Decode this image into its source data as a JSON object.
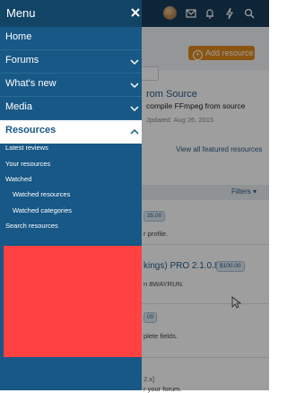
{
  "menu": {
    "title": "Menu",
    "items": [
      {
        "label": "Home",
        "expanded": false
      },
      {
        "label": "Forums",
        "expanded": false
      },
      {
        "label": "What's new",
        "expanded": false
      },
      {
        "label": "Media",
        "expanded": false
      },
      {
        "label": "Resources",
        "expanded": true
      }
    ],
    "resources_submenu": [
      "Latest reviews",
      "Your resources",
      "Watched",
      "Watched resources",
      "Watched categories",
      "Search resources"
    ]
  },
  "header_icons": [
    "avatar",
    "envelope-icon",
    "bell-icon",
    "bolt-icon",
    "search-icon"
  ],
  "background": {
    "add_button": "Add resource…",
    "featured": {
      "title": "rom Source",
      "description": "compile FFmpeg from source",
      "updated": "Jpdated: Aug 26, 2015"
    },
    "view_all": "View all featured resources",
    "filters": "Filters ▾",
    "rows": [
      {
        "price": "35.00",
        "text": "r profile."
      },
      {
        "title": "kings) PRO 2.1.0.8",
        "price": "$100.00",
        "text": "n 8WAYRUN."
      },
      {
        "price": "00",
        "text": "plete fields."
      },
      {
        "tag": "2.x]",
        "text": "r your forum."
      }
    ]
  },
  "colors": {
    "menu_bg": "#185886",
    "menu_header_bg": "#124466",
    "active_item_bg": "#ffffff",
    "accent_orange": "#df8a1c",
    "redacted_block": "#fe4242"
  }
}
